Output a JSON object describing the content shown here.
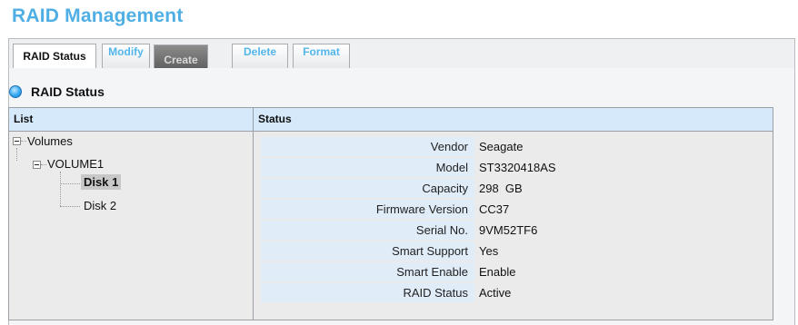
{
  "page": {
    "title": "RAID Management"
  },
  "tabs": [
    {
      "label": "RAID Status",
      "state": "active"
    },
    {
      "label": "Modify",
      "state": "normal"
    },
    {
      "label": "Create",
      "state": "disabled"
    },
    {
      "label": "Delete",
      "state": "normal"
    },
    {
      "label": "Format",
      "state": "normal"
    }
  ],
  "section": {
    "heading": "RAID Status",
    "icon": "circle-status-icon"
  },
  "table": {
    "columns": [
      "List",
      "Status"
    ],
    "tree": {
      "root": "Volumes",
      "volume": "VOLUME1",
      "disks": [
        "Disk 1",
        "Disk 2"
      ],
      "selected": "Disk 1"
    },
    "details": [
      {
        "label": "Vendor",
        "value": "Seagate"
      },
      {
        "label": "Model",
        "value": "ST3320418AS"
      },
      {
        "label": "Capacity",
        "value": "298  GB"
      },
      {
        "label": "Firmware Version",
        "value": "CC37"
      },
      {
        "label": "Serial No.",
        "value": "9VM52TF6"
      },
      {
        "label": "Smart Support",
        "value": "Yes"
      },
      {
        "label": "Smart Enable",
        "value": "Enable"
      },
      {
        "label": "RAID Status",
        "value": "Active"
      }
    ]
  },
  "colors": {
    "title": "#4faee3",
    "tab_text": "#52b6ea",
    "header_bg": "#d6e9fb",
    "label_bg": "#e0ecf8"
  }
}
